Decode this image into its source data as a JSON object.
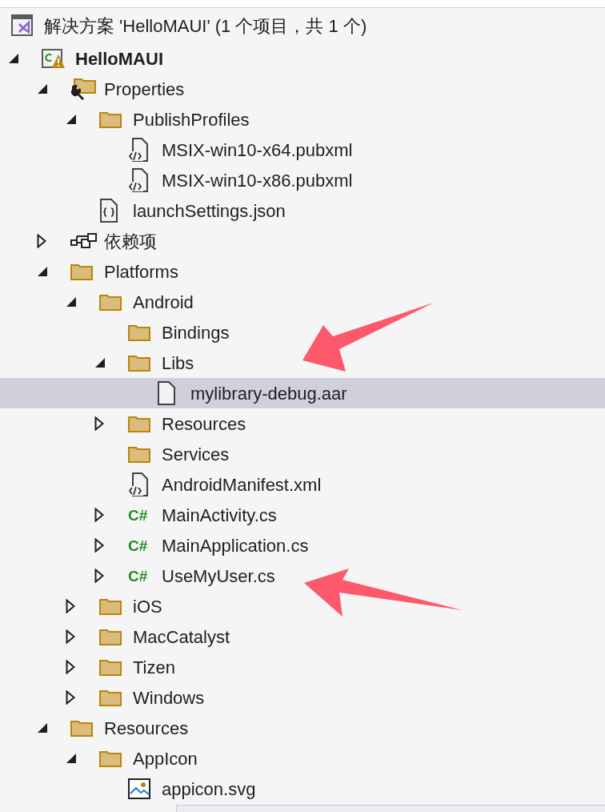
{
  "solution": {
    "label": "解决方案 'HelloMAUI' (1 个项目，共 1 个)"
  },
  "tree": [
    {
      "label": "HelloMAUI",
      "kind": "project",
      "expanded": true,
      "selected": false,
      "children": [
        {
          "label": "Properties",
          "kind": "properties",
          "expanded": true,
          "selected": false,
          "children": [
            {
              "label": "PublishProfiles",
              "kind": "folder",
              "expanded": true,
              "selected": false,
              "children": [
                {
                  "label": "MSIX-win10-x64.pubxml",
                  "kind": "xml",
                  "selected": false
                },
                {
                  "label": "MSIX-win10-x86.pubxml",
                  "kind": "xml",
                  "selected": false
                }
              ]
            },
            {
              "label": "launchSettings.json",
              "kind": "json",
              "selected": false
            }
          ]
        },
        {
          "label": "依赖项",
          "kind": "dependencies",
          "expanded": false,
          "selected": false
        },
        {
          "label": "Platforms",
          "kind": "folder",
          "expanded": true,
          "selected": false,
          "children": [
            {
              "label": "Android",
              "kind": "folder",
              "expanded": true,
              "selected": false,
              "children": [
                {
                  "label": "Bindings",
                  "kind": "folder",
                  "selected": false
                },
                {
                  "label": "Libs",
                  "kind": "folder",
                  "expanded": true,
                  "selected": false,
                  "children": [
                    {
                      "label": "mylibrary-debug.aar",
                      "kind": "file",
                      "selected": true
                    }
                  ]
                },
                {
                  "label": "Resources",
                  "kind": "folder",
                  "expanded": false,
                  "selected": false
                },
                {
                  "label": "Services",
                  "kind": "folder",
                  "selected": false
                },
                {
                  "label": "AndroidManifest.xml",
                  "kind": "xml",
                  "selected": false
                },
                {
                  "label": "MainActivity.cs",
                  "kind": "csharp",
                  "icon_text": "C#",
                  "expanded": false,
                  "selected": false
                },
                {
                  "label": "MainApplication.cs",
                  "kind": "csharp",
                  "icon_text": "C#",
                  "expanded": false,
                  "selected": false
                },
                {
                  "label": "UseMyUser.cs",
                  "kind": "csharp",
                  "icon_text": "C#",
                  "expanded": false,
                  "selected": false
                }
              ]
            },
            {
              "label": "iOS",
              "kind": "folder",
              "expanded": false,
              "selected": false
            },
            {
              "label": "MacCatalyst",
              "kind": "folder",
              "expanded": false,
              "selected": false
            },
            {
              "label": "Tizen",
              "kind": "folder",
              "expanded": false,
              "selected": false
            },
            {
              "label": "Windows",
              "kind": "folder",
              "expanded": false,
              "selected": false
            }
          ]
        },
        {
          "label": "Resources",
          "kind": "folder",
          "expanded": true,
          "selected": false,
          "children": [
            {
              "label": "AppIcon",
              "kind": "folder",
              "expanded": true,
              "selected": false,
              "children": [
                {
                  "label": "appicon.svg",
                  "kind": "image",
                  "selected": false
                }
              ]
            }
          ]
        }
      ]
    }
  ]
}
